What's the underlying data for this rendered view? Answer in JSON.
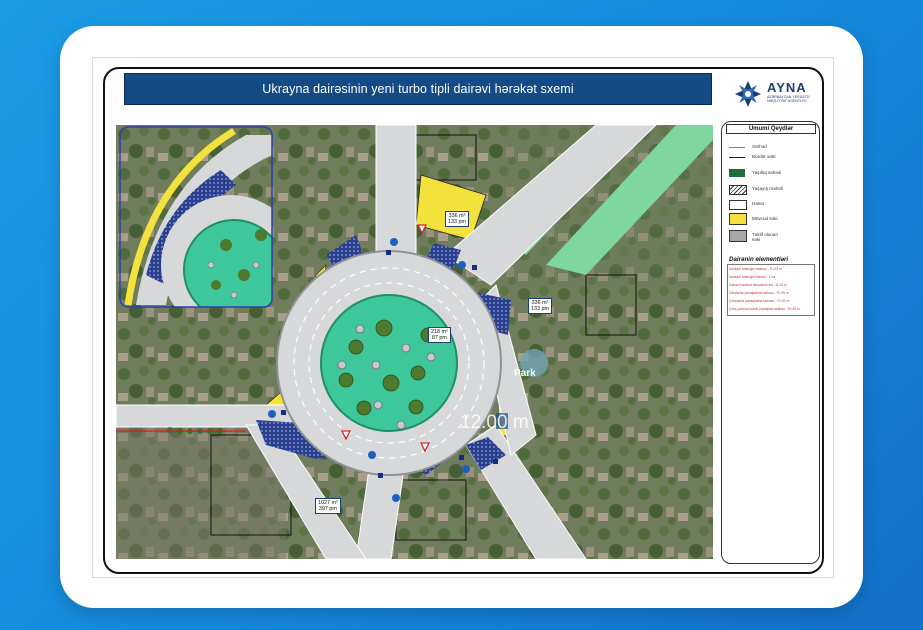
{
  "title": "Ukrayna dairəsinin yeni turbo tipli dairəvi hərəkət sxemi",
  "logo": {
    "name": "AYNA",
    "subtitle": "AZƏRBAYCAN YERÜSTÜ NƏQLİYYAT AGENTLİYİ",
    "icon": "ayna-logo-icon",
    "color": "#1b3f73"
  },
  "map": {
    "area_labels": [
      {
        "text": "336 m²\n133 pm"
      },
      {
        "text": "336 m²\n133 pm"
      },
      {
        "text": "218 m²\n87 pm"
      },
      {
        "text": "1027 m²\n397 pm"
      }
    ],
    "park_label": "Park",
    "distance_label": "12.00 m"
  },
  "legend": {
    "title": "Ümumi Qeydlər",
    "items": [
      {
        "label": "Sərhəd",
        "color": "#e35b5b"
      },
      {
        "label": "Bordür xətti",
        "color": "#222222"
      },
      {
        "label": "Yaşıllıq sahəsi",
        "color": "#1f6b3a"
      },
      {
        "label": "Yaşayış məhəli",
        "color": "#c8c8c8"
      },
      {
        "label": "Hasar",
        "color": "#ffffff"
      },
      {
        "label": "Mövcud səki",
        "color": "#f4e23c"
      },
      {
        "label": "Təklif olunan səki",
        "color": "#a8a8a8"
      }
    ],
    "elements_title": "Dairənin elementləri",
    "elements": [
      "Mərkəzi adacığın radiusu - R=23 m",
      "Mərkəzi adacığın sahəsi - 1 ha",
      "Dairəvi hərəkət hissəsinin eni - 8-10 m",
      "Girişlərdə yavaşlatma radiusu - R=25 m",
      "Çıxışlarda yavaşlatma radiusu - R=30 m",
      "Çıxış yolunun kəsik yanaşma radiusu - R=25 m"
    ]
  },
  "colors": {
    "background": "#1688dc",
    "title_bar": "#144a86",
    "road": "#d7d8da",
    "lane_line": "#ffffff",
    "island": "#3ec79a",
    "yellow": "#f4e23c",
    "stripe": "#2b3b9a"
  }
}
